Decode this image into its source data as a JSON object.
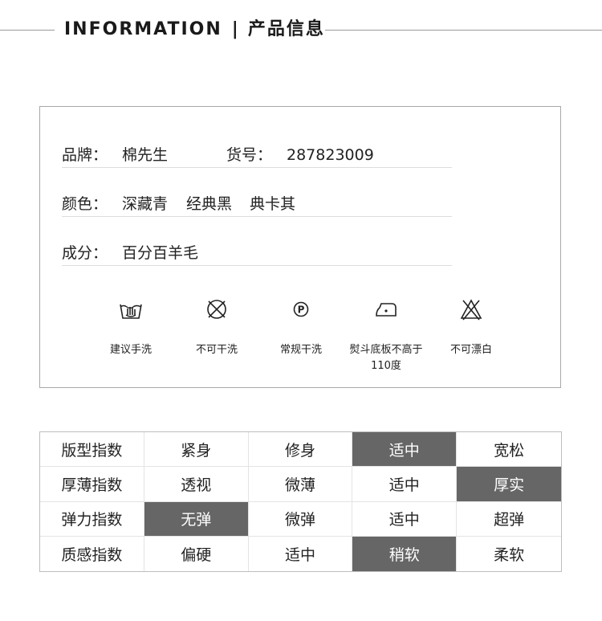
{
  "header": {
    "title_en": "INFORMATION",
    "separator": "|",
    "title_cn": "产品信息"
  },
  "info": {
    "brand_label": "品牌：",
    "brand_value": "棉先生",
    "sku_label": "货号：",
    "sku_value": "287823009",
    "color_label": "颜色：",
    "colors": [
      "深藏青",
      "经典黑",
      "典卡其"
    ],
    "material_label": "成分：",
    "material_value": "百分百羊毛"
  },
  "care": [
    {
      "icon": "hand-wash-icon",
      "label": "建议手洗"
    },
    {
      "icon": "no-dry-clean-icon",
      "label": "不可干洗"
    },
    {
      "icon": "dry-clean-p-icon",
      "label": "常规干洗"
    },
    {
      "icon": "iron-icon",
      "label": "熨斗底板不高于110度"
    },
    {
      "icon": "no-bleach-icon",
      "label": "不可漂白"
    }
  ],
  "indices": {
    "highlight_color": "#666666",
    "rows": [
      {
        "label": "版型指数",
        "options": [
          "紧身",
          "修身",
          "适中",
          "宽松"
        ],
        "selected": 2
      },
      {
        "label": "厚薄指数",
        "options": [
          "透视",
          "微薄",
          "适中",
          "厚实"
        ],
        "selected": 3
      },
      {
        "label": "弹力指数",
        "options": [
          "无弹",
          "微弹",
          "适中",
          "超弹"
        ],
        "selected": 0
      },
      {
        "label": "质感指数",
        "options": [
          "偏硬",
          "适中",
          "稍软",
          "柔软"
        ],
        "selected": 2
      }
    ]
  }
}
